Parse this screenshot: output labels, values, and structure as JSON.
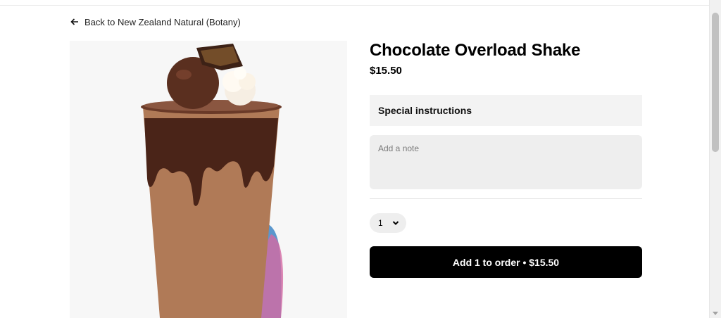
{
  "back_link": {
    "label": "Back to New Zealand Natural (Botany)"
  },
  "product": {
    "title": "Chocolate Overload Shake",
    "price": "$15.50",
    "image_icon": "milkshake-image"
  },
  "special_instructions": {
    "header": "Special instructions",
    "note_placeholder": "Add a note",
    "note_value": ""
  },
  "quantity": {
    "selected": "1"
  },
  "order_button": {
    "label": "Add 1 to order • $15.50"
  },
  "colors": {
    "accent": "#000000",
    "panel": "#f3f3f3",
    "field": "#eeeeee",
    "chocolate": "#5a2f1f",
    "milk": "#b07a57"
  }
}
